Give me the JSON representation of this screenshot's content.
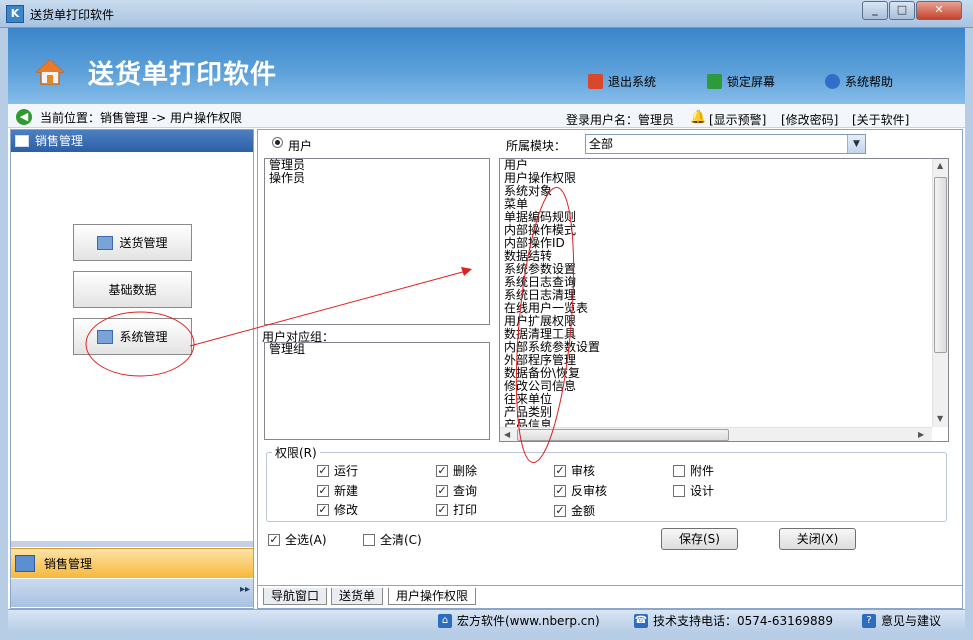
{
  "window": {
    "title": "送货单打印软件",
    "icon": "app-logo-icon",
    "controls": [
      "minimize",
      "maximize",
      "close"
    ]
  },
  "header": {
    "heading": "送货单打印软件",
    "links": [
      {
        "label": "退出系统",
        "icon": "exit-icon",
        "color": "#d9482c"
      },
      {
        "label": "锁定屏幕",
        "icon": "lock-screen-icon",
        "color": "#2f9a3a"
      },
      {
        "label": "系统帮助",
        "icon": "help-icon",
        "color": "#2f6fc8"
      }
    ]
  },
  "location": {
    "text": "当前位置：销售管理 -> 用户操作权限",
    "login_text": "登录用户名：管理员",
    "links": [
      "[显示预警]",
      "[修改密码]",
      "[关于软件]"
    ]
  },
  "sidebar": {
    "title": "销售管理",
    "buttons": [
      {
        "label": "送货管理",
        "has_icon": true
      },
      {
        "label": "基础数据",
        "has_icon": false
      },
      {
        "label": "系统管理",
        "has_icon": true
      }
    ],
    "bottom_tab": "销售管理"
  },
  "form": {
    "radio_label": "用户",
    "module_label": "所属模块：",
    "module_value": "全部",
    "users": [
      "管理员",
      "操作员"
    ],
    "groups_label": "用户对应组：",
    "groups": [
      "管理组"
    ],
    "modules": [
      "用户",
      "用户操作权限",
      "系统对象",
      "菜单",
      "单据编码规则",
      "内部操作模式",
      "内部操作ID",
      "数据结转",
      "系统参数设置",
      "系统日志查询",
      "系统日志清理",
      "在线用户一览表",
      "用户扩展权限",
      "数据清理工具",
      "内部系统参数设置",
      "外部程序管理",
      "数据备份\\恢复",
      "修改公司信息",
      "往来单位",
      "产品类别",
      "产品信息"
    ],
    "permissions_label": "权限(R)",
    "permissions": [
      {
        "label": "运行",
        "checked": true
      },
      {
        "label": "删除",
        "checked": true
      },
      {
        "label": "审核",
        "checked": true
      },
      {
        "label": "附件",
        "checked": false
      },
      {
        "label": "新建",
        "checked": true
      },
      {
        "label": "查询",
        "checked": true
      },
      {
        "label": "反审核",
        "checked": true
      },
      {
        "label": "设计",
        "checked": false
      },
      {
        "label": "修改",
        "checked": true
      },
      {
        "label": "打印",
        "checked": true
      },
      {
        "label": "金额",
        "checked": true
      }
    ],
    "select_all": {
      "label": "全选(A)",
      "checked": true
    },
    "clear_all": {
      "label": "全清(C)",
      "checked": false
    },
    "save_label": "保存(S)",
    "close_label": "关闭(X)"
  },
  "tabs": [
    "导航窗口",
    "送货单",
    "用户操作权限"
  ],
  "active_tab": 2,
  "statusbar": {
    "company": "宏方软件(www.nberp.cn)",
    "phone": "技术支持电话：0574-63169889",
    "feedback": "意见与建议"
  },
  "colors": {
    "header_blue": "#3a85c9",
    "sidebar_header": "#2c5fa6",
    "bottom_tab_orange": "#f7b83b",
    "annotation_red": "#e02020"
  }
}
